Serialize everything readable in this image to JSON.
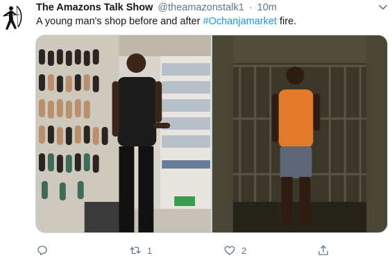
{
  "tweet": {
    "author_name": "The Amazons Talk Show",
    "handle": "@theamazonstalk1",
    "separator": "·",
    "time": "10m",
    "text_before": "A young man's shop before and after ",
    "hashtag": "#Ochanjamarket",
    "text_after": " fire."
  },
  "actions": {
    "reply_count": "",
    "retweet_count": "1",
    "like_count": "2"
  },
  "icons": {
    "avatar": "archer-silhouette-logo",
    "caret": "chevron-down-icon",
    "reply": "reply-icon",
    "retweet": "retweet-icon",
    "like": "heart-icon",
    "share": "share-icon"
  },
  "colors": {
    "text": "#14171a",
    "secondary": "#657786",
    "link": "#1b95e0"
  }
}
